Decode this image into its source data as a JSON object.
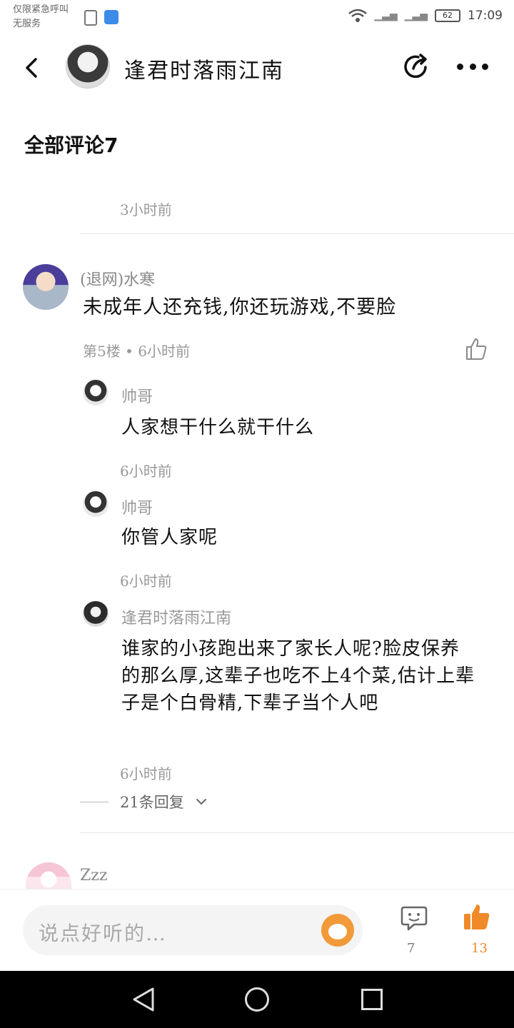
{
  "status_bar": {
    "line1": "仅限紧急呼叫",
    "line2": "无服务",
    "battery": "62",
    "time": "17:09"
  },
  "header": {
    "title": "逢君时落雨江南"
  },
  "section": {
    "title": "全部评论7"
  },
  "top_time": "3小时前",
  "comment": {
    "user": "(退网)水寒",
    "text": "未成年人还充钱,你还玩游戏,不要脸",
    "meta": "第5楼 • 6小时前"
  },
  "replies": [
    {
      "user": "帅哥",
      "text": "人家想干什么就干什么",
      "time": "6小时前"
    },
    {
      "user": "帅哥",
      "text": "你管人家呢",
      "time": "6小时前"
    },
    {
      "user": "逢君时落雨江南",
      "text": "谁家的小孩跑出来了家长人呢?脸皮保养的那么厚,这辈子也吃不上4个菜,估计上辈子是个白骨精,下辈子当个人吧",
      "time": "6小时前"
    }
  ],
  "more_replies": "21条回复",
  "next_comment": {
    "user": "Zzz"
  },
  "bottom_bar": {
    "placeholder": "说点好听的…",
    "comment_count": "7",
    "like_count": "13"
  },
  "colors": {
    "accent": "#f08a28",
    "muted": "#999999"
  }
}
